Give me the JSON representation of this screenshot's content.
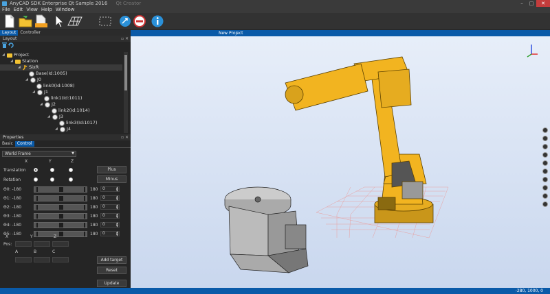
{
  "window": {
    "title": "AnyCAD SDK Enterprise Qt Sample 2016",
    "ghost_tab": "Qt Creator",
    "buttons": [
      "–",
      "□",
      "✕"
    ]
  },
  "menu": [
    "File",
    "Edit",
    "View",
    "Help",
    "Window"
  ],
  "toolbar": {
    "icons": [
      "new-file-icon",
      "open-folder-icon",
      "save-icon",
      "select-cursor-icon",
      "grid-icon",
      "dashed-box-icon",
      "rotate-icon",
      "stop-icon",
      "info-icon"
    ]
  },
  "left_tabs": {
    "layout": "Layout",
    "controller": "Controller"
  },
  "layout_panel": {
    "title": "Layout"
  },
  "tree": [
    {
      "label": "Project",
      "type": "folder",
      "depth": 0
    },
    {
      "label": "Station",
      "type": "folder",
      "depth": 1
    },
    {
      "label": "SixR",
      "type": "robot",
      "depth": 2,
      "selected": true
    },
    {
      "label": "Base(Id:1005)",
      "type": "part",
      "depth": 3
    },
    {
      "label": "J0",
      "type": "joint",
      "depth": 3
    },
    {
      "label": "link0(Id:1008)",
      "type": "part",
      "depth": 4
    },
    {
      "label": "J1",
      "type": "joint",
      "depth": 4
    },
    {
      "label": "link1(Id:1011)",
      "type": "part",
      "depth": 5
    },
    {
      "label": "J2",
      "type": "joint",
      "depth": 5
    },
    {
      "label": "link2(Id:1014)",
      "type": "part",
      "depth": 6
    },
    {
      "label": "J3",
      "type": "joint",
      "depth": 6
    },
    {
      "label": "link3(Id:1017)",
      "type": "part",
      "depth": 7
    },
    {
      "label": "J4",
      "type": "joint",
      "depth": 7
    }
  ],
  "properties": {
    "title": "Properties",
    "tabs": [
      "Basic",
      "Control"
    ]
  },
  "control": {
    "frame": "World Frame",
    "axes": [
      "X",
      "Y",
      "Z"
    ],
    "translation_label": "Translation",
    "rotation_label": "Rotation",
    "plus_label": "Plus",
    "minus_label": "Minus",
    "joints": [
      {
        "label": "Θ0: -180",
        "max": "180",
        "value": "0"
      },
      {
        "label": "Θ1: -180",
        "max": "180",
        "value": "0"
      },
      {
        "label": "Θ2: -180",
        "max": "180",
        "value": "0"
      },
      {
        "label": "Θ3: -180",
        "max": "180",
        "value": "0"
      },
      {
        "label": "Θ4: -180",
        "max": "180",
        "value": "0"
      },
      {
        "label": "Θ5: -180",
        "max": "180",
        "value": "0"
      }
    ],
    "pos_label": "Pos:",
    "abc": [
      "A",
      "B",
      "C"
    ],
    "add_target": "Add target",
    "reset": "Reset",
    "update": "Update"
  },
  "viewport": {
    "tab": "New Project"
  },
  "status": {
    "coords": "-280, 1000, 0"
  },
  "colors": {
    "accent": "#0a5aa8",
    "robot": "#f2b420",
    "viewport_top": "#e7eef9"
  }
}
